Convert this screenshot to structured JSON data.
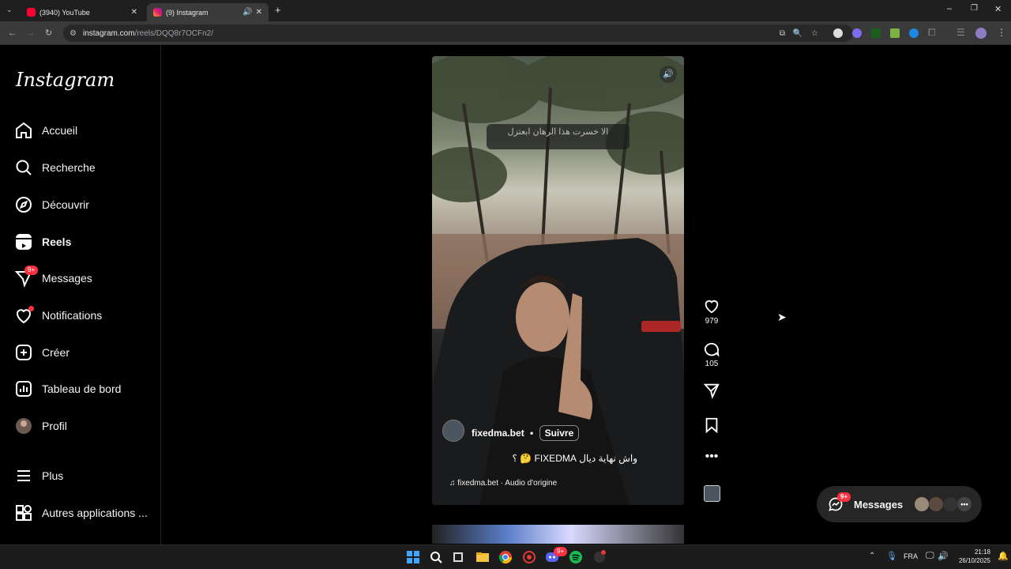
{
  "browser": {
    "tabs": [
      {
        "title": "(3940) YouTube",
        "active": false
      },
      {
        "title": "(9) Instagram",
        "active": true
      }
    ],
    "url_host": "instagram.com",
    "url_path": "/reels/DQQ8r7OCFn2/"
  },
  "sidebar": {
    "logo": "Instagram",
    "items": [
      {
        "label": "Accueil",
        "icon": "home-icon"
      },
      {
        "label": "Recherche",
        "icon": "search-icon"
      },
      {
        "label": "Découvrir",
        "icon": "compass-icon"
      },
      {
        "label": "Reels",
        "icon": "reels-icon"
      },
      {
        "label": "Messages",
        "icon": "messenger-icon",
        "badge": "9+"
      },
      {
        "label": "Notifications",
        "icon": "heart-icon"
      },
      {
        "label": "Créer",
        "icon": "plus-square-icon"
      },
      {
        "label": "Tableau de bord",
        "icon": "dashboard-icon"
      },
      {
        "label": "Profil",
        "icon": "avatar"
      },
      {
        "label": "Plus",
        "icon": "menu-icon"
      },
      {
        "label": "Autres applications ...",
        "icon": "apps-icon"
      }
    ]
  },
  "reel": {
    "overlay_text": "الا خسرت هذا الرهان ابعتزل",
    "username": "fixedma.bet",
    "separator": "•",
    "follow": "Suivre",
    "caption": "واش نهاية ديال FIXEDMA 🤔 ؟",
    "audio": "fixedma.bet · Audio d'origine",
    "likes": "979",
    "comments": "105"
  },
  "messages_pill": {
    "label": "Messages",
    "badge": "9+"
  },
  "taskbar": {
    "lang": "FRA",
    "time": "21:18",
    "date": "26/10/2025"
  },
  "colors": {
    "badge": "#ff3040",
    "background": "#000000"
  }
}
